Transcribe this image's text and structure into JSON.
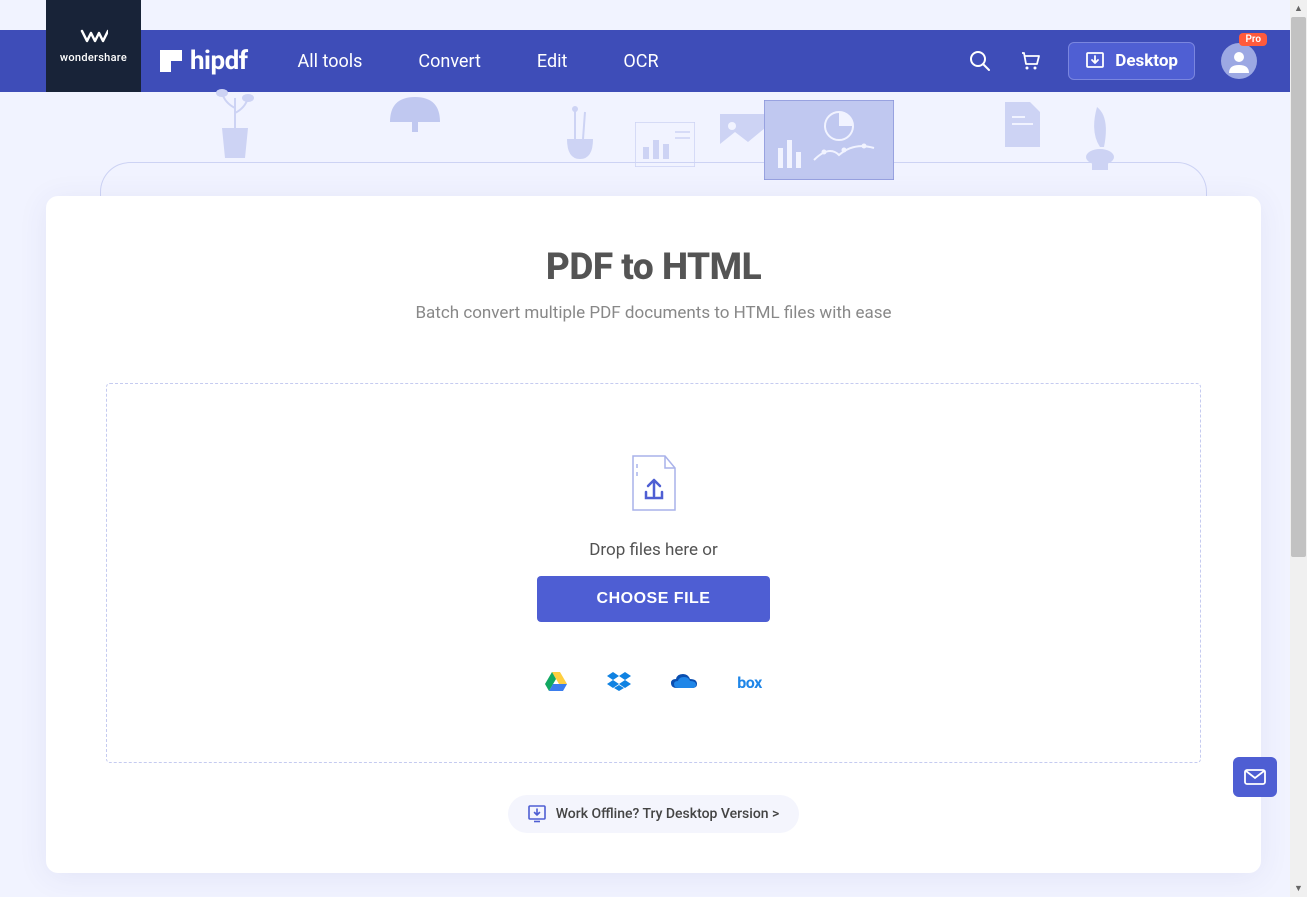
{
  "brand": {
    "wondershare": "wondershare",
    "hipdf": "hipdf"
  },
  "nav": {
    "all_tools": "All tools",
    "convert": "Convert",
    "edit": "Edit",
    "ocr": "OCR",
    "desktop": "Desktop",
    "pro_badge": "Pro"
  },
  "main": {
    "title": "PDF to HTML",
    "subtitle": "Batch convert multiple PDF documents to HTML files with ease",
    "drop_text": "Drop files here or",
    "choose_file": "CHOOSE FILE",
    "offline_text": "Work Offline? Try Desktop Version >",
    "box_label": "box"
  }
}
